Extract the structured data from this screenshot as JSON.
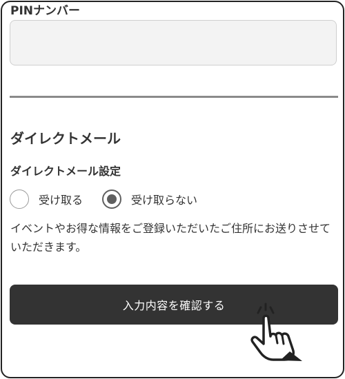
{
  "pin": {
    "label": "PINナンバー",
    "value": "",
    "placeholder": ""
  },
  "direct_mail": {
    "section_title": "ダイレクトメール",
    "setting_label": "ダイレクトメール設定",
    "options": [
      {
        "label": "受け取る",
        "checked": false
      },
      {
        "label": "受け取らない",
        "checked": true
      }
    ],
    "selected": "受け取らない",
    "notice": "イベントやお得な情報をご登録いただいたご住所にお送りさせていただきます。"
  },
  "submit": {
    "label": "入力内容を確認する"
  },
  "icons": {
    "pointer": "pointing-hand-icon"
  },
  "colors": {
    "button_bg": "#333333",
    "button_text": "#ffffff",
    "input_bg": "#f3f3f3",
    "divider": "#8a8a8a",
    "radio_checked": "#5f5f5f"
  }
}
